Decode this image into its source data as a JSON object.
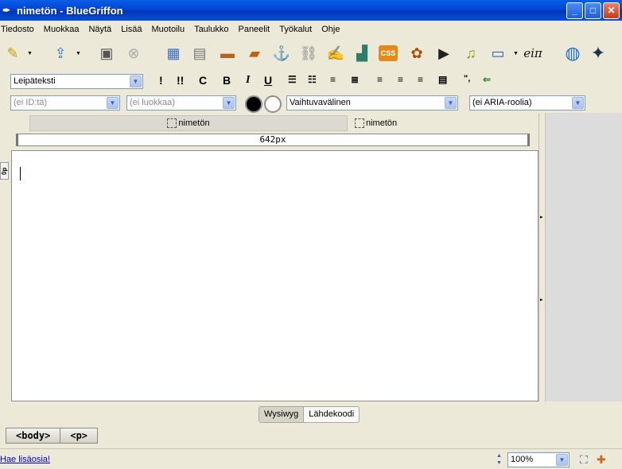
{
  "window": {
    "title": "nimetön - BlueGriffon",
    "minimize": "_",
    "maximize": "□",
    "close": "✕"
  },
  "menu": [
    "Tiedosto",
    "Muokkaa",
    "Näytä",
    "Lisää",
    "Muotoilu",
    "Taulukko",
    "Paneelit",
    "Työkalut",
    "Ohje"
  ],
  "toolbar": {
    "icons": [
      "new-document-icon",
      "open-icon",
      "save-icon",
      "stop-icon",
      "table-icon",
      "table-border-icon",
      "image-icon",
      "images-icon",
      "anchor-icon",
      "link-icon",
      "form-icon",
      "blocks-icon",
      "css-icon",
      "flower-icon",
      "video-icon",
      "audio-icon",
      "window-icon",
      "math-icon",
      "globe-icon",
      "griffin-icon"
    ],
    "math_label": "eiπ",
    "css_label": "CSS"
  },
  "format": {
    "paragraph_style": "Leipäteksti",
    "buttons": {
      "exclaim": "!",
      "double_exclaim": "!!",
      "code": "C",
      "bold": "B",
      "italic": "I",
      "underline": "U",
      "quote": "\"‟”"
    }
  },
  "attributes": {
    "id_placeholder": "(ei ID:tä)",
    "class_placeholder": "(ei luokkaa)",
    "variant": "Vaihtuvavälinen",
    "aria": "(ei ARIA-roolia)",
    "colors": {
      "foreground": "#000000",
      "background": "#ffffff"
    }
  },
  "tabs": [
    {
      "label": "nimetön",
      "active": false
    },
    {
      "label": "nimetön",
      "active": true
    }
  ],
  "ruler": {
    "width_label": "642px"
  },
  "editor": {
    "side_marker": "0p"
  },
  "view_switch": {
    "wysiwyg": "Wysiwyg",
    "source": "Lähdekoodi",
    "active": "wysiwyg"
  },
  "breadcrumb": [
    "<body>",
    "<p>"
  ],
  "status": {
    "link": "Hae lisäosia!",
    "zoom": "100%"
  }
}
